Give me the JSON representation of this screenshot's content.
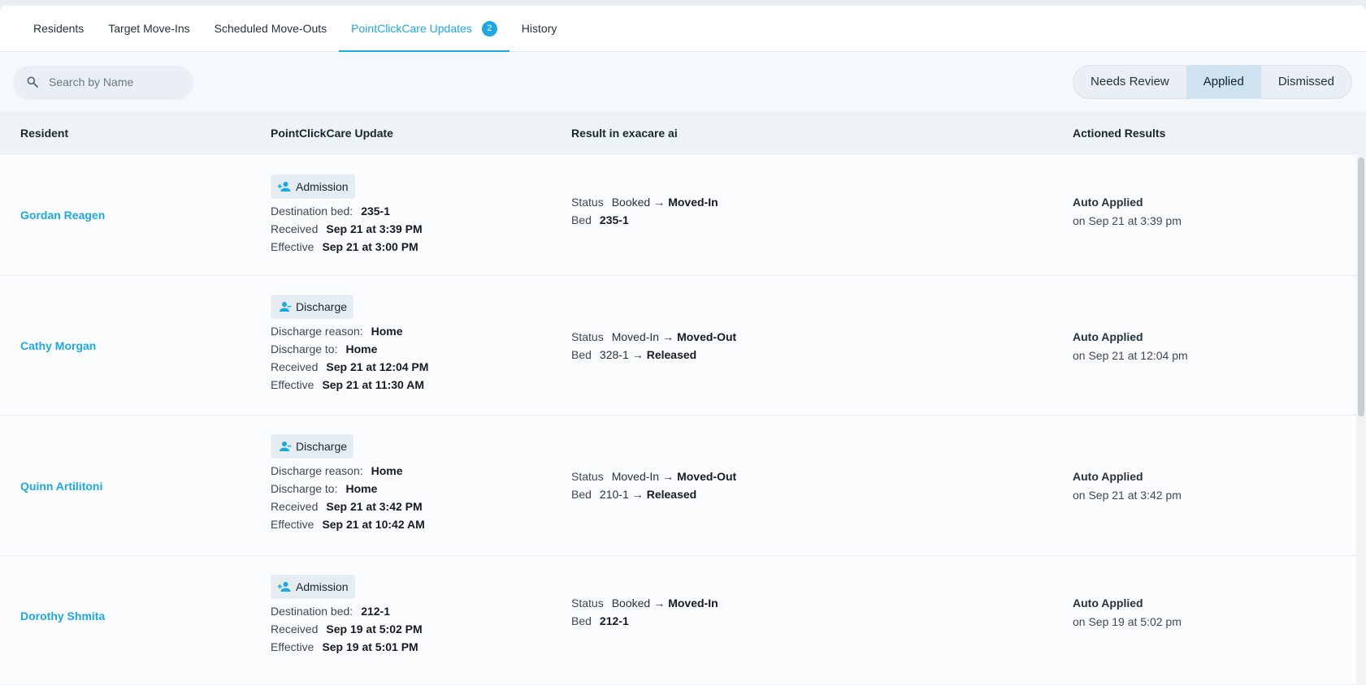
{
  "tabs": [
    {
      "label": "Residents",
      "active": false
    },
    {
      "label": "Target Move-Ins",
      "active": false
    },
    {
      "label": "Scheduled Move-Outs",
      "active": false
    },
    {
      "label": "PointClickCare Updates",
      "active": true,
      "badge": "2"
    },
    {
      "label": "History",
      "active": false
    }
  ],
  "search": {
    "placeholder": "Search by Name",
    "value": ""
  },
  "filters": [
    {
      "label": "Needs Review",
      "active": false
    },
    {
      "label": "Applied",
      "active": true
    },
    {
      "label": "Dismissed",
      "active": false
    }
  ],
  "columns": [
    "Resident",
    "PointClickCare Update",
    "Result in exacare ai",
    "Actioned Results"
  ],
  "icons": {
    "search": "search-icon",
    "admission": "person-add-icon",
    "discharge": "person-remove-icon"
  },
  "colors": {
    "accent": "#1ea8e0"
  },
  "rows": [
    {
      "name": "Gordan Reagen",
      "type": "Admission",
      "destination_label": "Destination bed:",
      "destination": "235-1",
      "received_label": "Received",
      "received": "Sep 21 at 3:39 PM",
      "effective_label": "Effective",
      "effective": "Sep 21 at 3:00 PM",
      "status_label": "Status",
      "status_from": "Booked",
      "status_to": "Moved-In",
      "bed_label": "Bed",
      "bed": "235-1",
      "action": "Auto Applied",
      "action_time": "on Sep 21 at 3:39 pm"
    },
    {
      "name": "Cathy Morgan",
      "type": "Discharge",
      "reason_label": "Discharge reason:",
      "reason": "Home",
      "to_label": "Discharge to:",
      "to": "Home",
      "received_label": "Received",
      "received": "Sep 21 at 12:04 PM",
      "effective_label": "Effective",
      "effective": "Sep 21 at 11:30 AM",
      "status_label": "Status",
      "status_from": "Moved-In",
      "status_to": "Moved-Out",
      "bed_label": "Bed",
      "bed_from": "328-1",
      "bed_to": "Released",
      "action": "Auto Applied",
      "action_time": "on Sep 21 at 12:04 pm"
    },
    {
      "name": "Quinn Artilitoni",
      "type": "Discharge",
      "reason_label": "Discharge reason:",
      "reason": "Home",
      "to_label": "Discharge to:",
      "to": "Home",
      "received_label": "Received",
      "received": "Sep 21 at 3:42 PM",
      "effective_label": "Effective",
      "effective": "Sep 21 at 10:42 AM",
      "status_label": "Status",
      "status_from": "Moved-In",
      "status_to": "Moved-Out",
      "bed_label": "Bed",
      "bed_from": "210-1",
      "bed_to": "Released",
      "action": "Auto Applied",
      "action_time": "on Sep 21 at 3:42 pm"
    },
    {
      "name": "Dorothy Shmita",
      "type": "Admission",
      "destination_label": "Destination bed:",
      "destination": "212-1",
      "received_label": "Received",
      "received": "Sep 19 at 5:02 PM",
      "effective_label": "Effective",
      "effective": "Sep 19 at 5:01 PM",
      "status_label": "Status",
      "status_from": "Booked",
      "status_to": "Moved-In",
      "bed_label": "Bed",
      "bed": "212-1",
      "action": "Auto Applied",
      "action_time": "on Sep 19 at 5:02 pm"
    }
  ]
}
